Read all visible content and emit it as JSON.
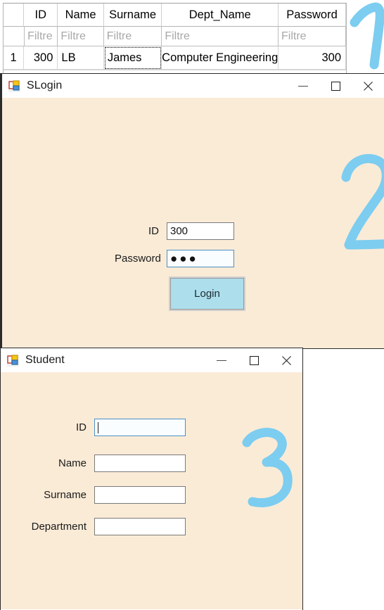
{
  "accent_blue": "#7ccdf0",
  "form_background": "#faebd7",
  "button_color": "#addeeb",
  "grid": {
    "name": "student-datagridview",
    "columns": [
      {
        "key": "rowhdr",
        "label": ""
      },
      {
        "key": "id",
        "label": "ID"
      },
      {
        "key": "name",
        "label": "Name"
      },
      {
        "key": "surname",
        "label": "Surname"
      },
      {
        "key": "dept",
        "label": "Dept_Name"
      },
      {
        "key": "password",
        "label": "Password"
      }
    ],
    "filter_placeholder": "Filtre",
    "rows": [
      {
        "row_number": "1",
        "id": "300",
        "name": "LB",
        "surname": "James",
        "dept": "Computer Engineering",
        "password": "300"
      }
    ]
  },
  "slogin": {
    "title": "SLogin",
    "icon": "windows-form-icon",
    "minimize_label": "—",
    "maximize_label": "□",
    "close_label": "✕",
    "fields": [
      {
        "label": "ID",
        "value": "300",
        "focused": false
      },
      {
        "label": "Password",
        "value": "●●●",
        "focused": true
      }
    ],
    "login_button": "Login"
  },
  "student": {
    "title": "Student",
    "icon": "windows-form-icon",
    "minimize_label": "—",
    "maximize_label": "□",
    "close_label": "✕",
    "fields": [
      {
        "label": "ID",
        "value": "",
        "focused": true
      },
      {
        "label": "Name",
        "value": "",
        "focused": false
      },
      {
        "label": "Surname",
        "value": "",
        "focused": false
      },
      {
        "label": "Department",
        "value": "",
        "focused": false
      }
    ]
  },
  "annotations": [
    {
      "label": "1",
      "target": "datagridview"
    },
    {
      "label": "2",
      "target": "slogin-window"
    },
    {
      "label": "3",
      "target": "student-window"
    }
  ]
}
